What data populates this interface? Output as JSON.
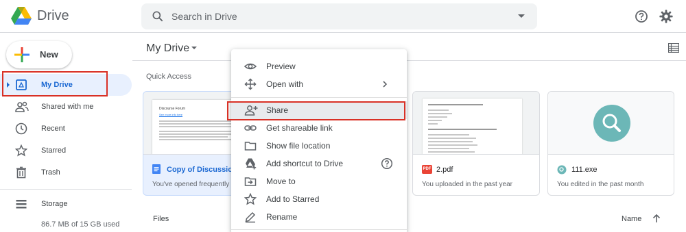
{
  "header": {
    "app_name": "Drive",
    "search_placeholder": "Search in Drive"
  },
  "sidebar": {
    "new_label": "New",
    "items": [
      {
        "label": "My Drive",
        "icon": "my-drive-icon",
        "active": true
      },
      {
        "label": "Shared with me",
        "icon": "people-icon"
      },
      {
        "label": "Recent",
        "icon": "clock-icon"
      },
      {
        "label": "Starred",
        "icon": "star-icon"
      },
      {
        "label": "Trash",
        "icon": "trash-icon"
      }
    ],
    "storage_label": "Storage",
    "storage_used": "86.7 MB of 15 GB used"
  },
  "main": {
    "title": "My Drive",
    "quick_access_label": "Quick Access",
    "cards": [
      {
        "name": "Copy of Discussion",
        "subtitle": "You've opened frequently",
        "icon": "google-docs-icon",
        "selected": true,
        "preview_title": "Discourse Forum",
        "preview_link": "See more info here"
      },
      {
        "name": "2.pdf",
        "subtitle": "You uploaded in the past year",
        "icon": "pdf-icon",
        "pdf_badge": "PDF"
      },
      {
        "name": "111.exe",
        "subtitle": "You edited in the past month",
        "icon": "exe-icon"
      }
    ],
    "files_label": "Files",
    "sort_label": "Name"
  },
  "context_menu": {
    "items": [
      {
        "label": "Preview",
        "icon": "eye-icon"
      },
      {
        "label": "Open with",
        "icon": "move-arrows-icon",
        "has_submenu": true
      },
      {
        "label": "Share",
        "icon": "add-person-icon",
        "highlighted": true
      },
      {
        "label": "Get shareable link",
        "icon": "link-icon"
      },
      {
        "label": "Show file location",
        "icon": "folder-icon"
      },
      {
        "label": "Add shortcut to Drive",
        "icon": "drive-shortcut-icon",
        "has_help": true
      },
      {
        "label": "Move to",
        "icon": "move-to-icon"
      },
      {
        "label": "Add to Starred",
        "icon": "star-icon"
      },
      {
        "label": "Rename",
        "icon": "pencil-icon"
      }
    ]
  },
  "colors": {
    "accent_blue": "#1967d2",
    "active_bg": "#e8f0fe",
    "highlight_red": "#d93025",
    "exe_teal": "#6cb7b7"
  }
}
